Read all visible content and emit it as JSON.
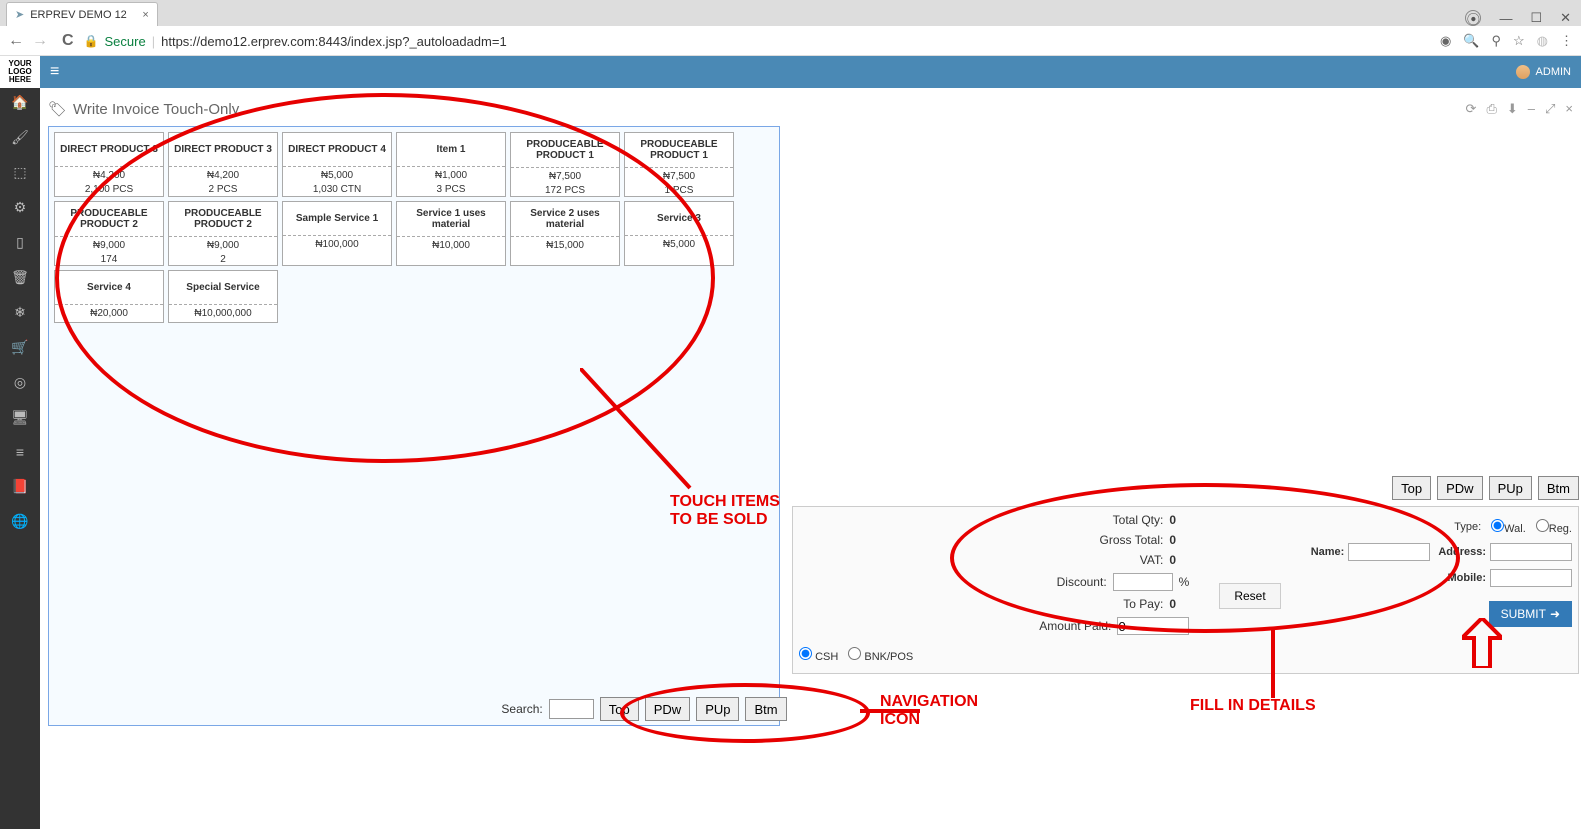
{
  "browser": {
    "tab_title": "ERPREV DEMO 12",
    "secure_label": "Secure",
    "url": "https://demo12.erprev.com:8443/index.jsp?_autoloadadm=1"
  },
  "app": {
    "logo_l1": "YOUR",
    "logo_l2": "LOGO",
    "logo_l3": "HERE",
    "user_label": "ADMIN"
  },
  "page": {
    "title": "Write Invoice Touch-Only"
  },
  "products": [
    {
      "name": "DIRECT PRODUCT 3",
      "price": "₦4,200",
      "qty": "2,100 PCS"
    },
    {
      "name": "DIRECT PRODUCT 3",
      "price": "₦4,200",
      "qty": "2 PCS"
    },
    {
      "name": "DIRECT PRODUCT 4",
      "price": "₦5,000",
      "qty": "1,030 CTN"
    },
    {
      "name": "Item 1",
      "price": "₦1,000",
      "qty": "3 PCS"
    },
    {
      "name": "PRODUCEABLE PRODUCT 1",
      "price": "₦7,500",
      "qty": "172 PCS"
    },
    {
      "name": "PRODUCEABLE PRODUCT 1",
      "price": "₦7,500",
      "qty": "1 PCS"
    },
    {
      "name": "PRODUCEABLE PRODUCT 2",
      "price": "₦9,000",
      "qty": "174"
    },
    {
      "name": "PRODUCEABLE PRODUCT 2",
      "price": "₦9,000",
      "qty": "2"
    },
    {
      "name": "Sample Service 1",
      "price": "₦100,000",
      "qty": ""
    },
    {
      "name": "Service 1 uses material",
      "price": "₦10,000",
      "qty": ""
    },
    {
      "name": "Service 2 uses material",
      "price": "₦15,000",
      "qty": ""
    },
    {
      "name": "Service 3",
      "price": "₦5,000",
      "qty": ""
    },
    {
      "name": "Service 4",
      "price": "₦20,000",
      "qty": ""
    },
    {
      "name": "Special Service",
      "price": "₦10,000,000",
      "qty": ""
    }
  ],
  "search_label": "Search:",
  "nav": {
    "top": "Top",
    "pdw": "PDw",
    "pup": "PUp",
    "btm": "Btm"
  },
  "summary": {
    "total_qty_lbl": "Total Qty:",
    "total_qty": "0",
    "gross_lbl": "Gross Total:",
    "gross": "0",
    "vat_lbl": "VAT:",
    "vat": "0",
    "discount_lbl": "Discount:",
    "discount_unit": "%",
    "topay_lbl": "To Pay:",
    "topay": "0",
    "paid_lbl": "Amount Paid:",
    "paid_val": "0",
    "csh": "CSH",
    "bnkpos": "BNK/POS",
    "type_lbl": "Type:",
    "wal": "Wal.",
    "reg": "Reg.",
    "name_lbl": "Name:",
    "addr_lbl": "Address:",
    "mobile_lbl": "Mobile:",
    "reset": "Reset",
    "submit": "SUBMIT"
  },
  "annotations": {
    "touch_l1": "TOUCH ITEMS",
    "touch_l2": "TO BE SOLD",
    "nav_l1": "NAVIGATION",
    "nav_l2": "ICON",
    "fill": "FILL IN DETAILS"
  }
}
